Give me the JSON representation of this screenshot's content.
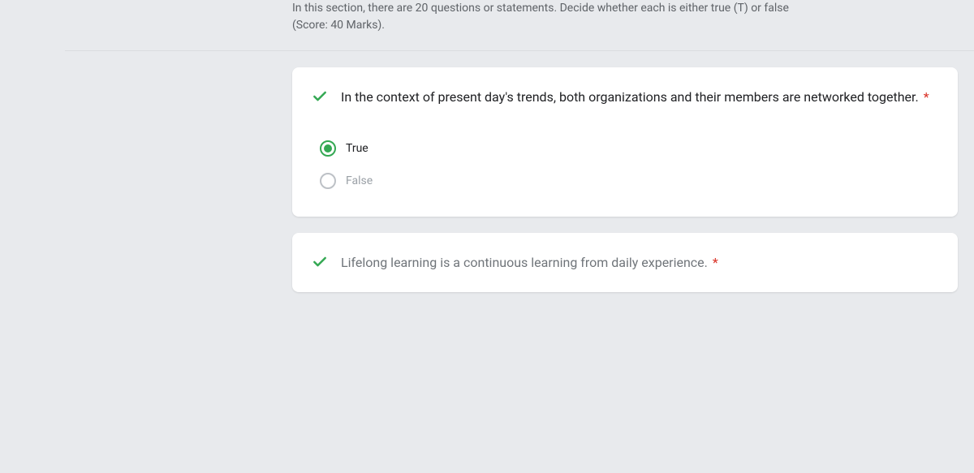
{
  "section": {
    "instruction_line1": "In this section, there are 20 questions or statements. Decide whether each is either true (T) or false",
    "instruction_line2": "(Score: 40 Marks)."
  },
  "question1": {
    "text": "In the context of present day's trends, both organizations and their members are networked together.",
    "required_marker": "*",
    "status": "correct",
    "options": {
      "true_label": "True",
      "false_label": "False",
      "selected": "true"
    }
  },
  "question2": {
    "text": "Lifelong learning is a continuous learning from daily experience.",
    "required_marker": "*",
    "status": "correct"
  }
}
